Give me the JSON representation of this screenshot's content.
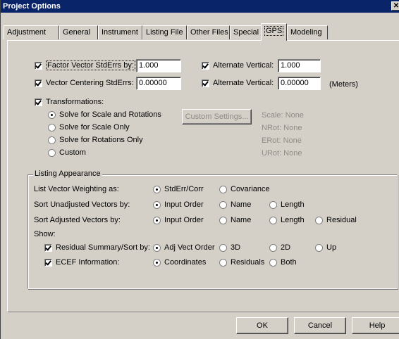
{
  "window": {
    "title": "Project Options",
    "close_glyph": "✕"
  },
  "tabs": [
    {
      "label": "Adjustment"
    },
    {
      "label": "General"
    },
    {
      "label": "Instrument"
    },
    {
      "label": "Listing File"
    },
    {
      "label": "Other Files"
    },
    {
      "label": "Special"
    },
    {
      "label": "GPS"
    },
    {
      "label": "Modeling"
    }
  ],
  "active_tab": "GPS",
  "factor_vector": {
    "label": "Factor Vector StdErrs by:",
    "checked": true,
    "value": "1.000"
  },
  "alt_vertical_1": {
    "label": "Alternate Vertical:",
    "checked": true,
    "value": "1.000"
  },
  "vector_centering": {
    "label": "Vector Centering StdErrs:",
    "checked": true,
    "value": "0.00000"
  },
  "alt_vertical_2": {
    "label": "Alternate Vertical:",
    "checked": true,
    "value": "0.00000",
    "unit": "(Meters)"
  },
  "transformations": {
    "label": "Transformations:",
    "checked": true,
    "options": [
      {
        "label": "Solve for Scale and Rotations",
        "selected": true
      },
      {
        "label": "Solve for Scale Only",
        "selected": false
      },
      {
        "label": "Solve for Rotations Only",
        "selected": false
      },
      {
        "label": "Custom",
        "selected": false
      }
    ],
    "custom_button": "Custom Settings...",
    "readouts": [
      "Scale: None",
      "NRot: None",
      "ERot: None",
      "URot: None"
    ]
  },
  "listing": {
    "title": "Listing Appearance",
    "weighting": {
      "label": "List Vector Weighting as:",
      "options": [
        "StdErr/Corr",
        "Covariance"
      ],
      "selected": "StdErr/Corr"
    },
    "unadjusted": {
      "label": "Sort Unadjusted Vectors by:",
      "options": [
        "Input Order",
        "Name",
        "Length"
      ],
      "selected": "Input Order"
    },
    "adjusted": {
      "label": "Sort Adjusted Vectors by:",
      "options": [
        "Input Order",
        "Name",
        "Length",
        "Residual"
      ],
      "selected": "Input Order"
    },
    "show_label": "Show:",
    "residual_summary": {
      "label": "Residual Summary/Sort by:",
      "checked": true,
      "options": [
        "Adj Vect Order",
        "3D",
        "2D",
        "Up"
      ],
      "selected": "Adj Vect Order"
    },
    "ecef": {
      "label": "ECEF Information:",
      "checked": true,
      "options": [
        "Coordinates",
        "Residuals",
        "Both"
      ],
      "selected": "Coordinates"
    }
  },
  "buttons": {
    "ok": "OK",
    "cancel": "Cancel",
    "help": "Help"
  }
}
